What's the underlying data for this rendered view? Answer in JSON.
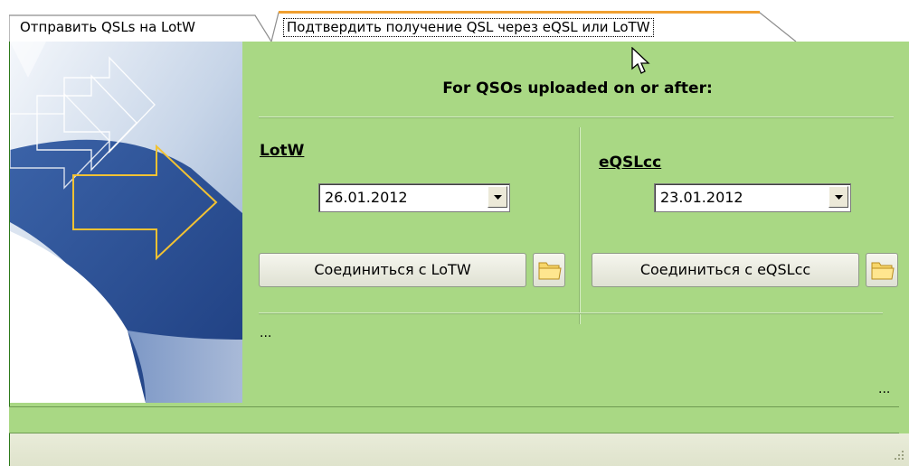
{
  "tabs": [
    {
      "label": "Отправить QSLs на LotW",
      "active": false
    },
    {
      "label": "Подтвердить получение QSL через eQSL или LoTW",
      "active": true
    }
  ],
  "header": {
    "title": "For QSOs uploaded on or after:"
  },
  "lotw": {
    "label": "LotW",
    "date": "26.01.2012",
    "connect_label": "Соединиться с LoTW"
  },
  "eqsl": {
    "label": "eQSLcc",
    "date": "23.01.2012",
    "connect_label": "Соединиться с eQSLcc"
  },
  "status": {
    "left_text": "...",
    "right_text": "..."
  },
  "icons": {
    "folder": "folder-icon",
    "dropdown": "chevron-down-icon",
    "cursor": "mouse-pointer-icon",
    "grip": "resize-grip-icon"
  },
  "colors": {
    "panel": "#a9d884",
    "active_tab_accent": "#f0a030",
    "footer": "#e6e9d4"
  }
}
